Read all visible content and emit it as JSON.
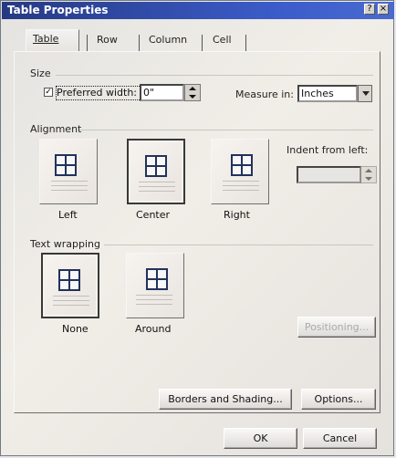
{
  "window": {
    "title": "Table Properties",
    "help_button": "?",
    "close_button": "×"
  },
  "tabs": [
    {
      "label": "Table",
      "active": true
    },
    {
      "label": "Row",
      "active": false
    },
    {
      "label": "Column",
      "active": false
    },
    {
      "label": "Cell",
      "active": false
    }
  ],
  "size": {
    "section_label": "Size",
    "preferred_width_checked": true,
    "preferred_width_label": "Preferred width:",
    "preferred_width_value": "0\"",
    "measure_label": "Measure in:",
    "measure_value": "Inches"
  },
  "alignment": {
    "section_label": "Alignment",
    "options": [
      {
        "label": "Left",
        "selected": false
      },
      {
        "label": "Center",
        "selected": true
      },
      {
        "label": "Right",
        "selected": false
      }
    ],
    "indent_label": "Indent from left:",
    "indent_value": ""
  },
  "text_wrapping": {
    "section_label": "Text wrapping",
    "options": [
      {
        "label": "None",
        "selected": true
      },
      {
        "label": "Around",
        "selected": false
      }
    ],
    "positioning_button": "Positioning..."
  },
  "footer_buttons": {
    "borders": "Borders and Shading...",
    "options": "Options...",
    "ok": "OK",
    "cancel": "Cancel"
  },
  "colors": {
    "title_blue": "#263a83",
    "selected_border": "#383838"
  },
  "icons": {
    "table": "table-grid-icon",
    "checkbox": "checkmark-icon"
  }
}
